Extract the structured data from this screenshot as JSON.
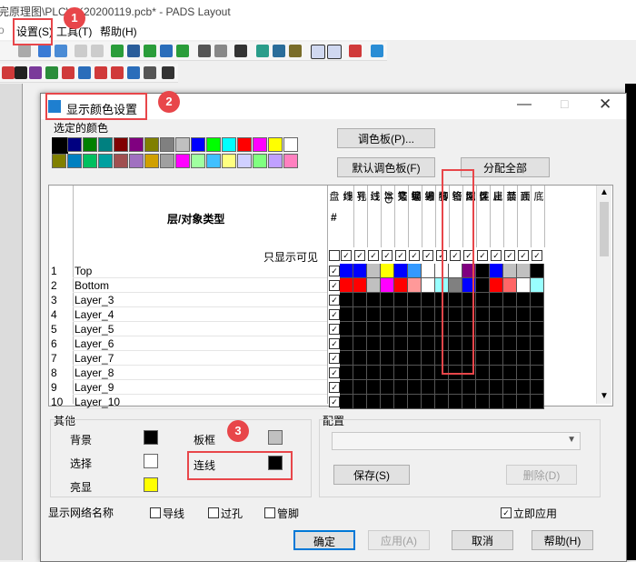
{
  "window": {
    "title": "完原理图\\PLCWK20200119.pcb* - PADS Layout"
  },
  "menu": {
    "settings": "设置(S)",
    "tools": "工具(T)",
    "help": "帮助(H)"
  },
  "dialog": {
    "title": "显示颜色设置",
    "selected_colors_label": "选定的颜色",
    "palette_button": "调色板(P)...",
    "default_palette_button": "默认调色板(F)",
    "assign_all_button": "分配全部",
    "table": {
      "layer_header": "层/对象类型",
      "hash_header": "#",
      "visible_only_label": "只显示可见",
      "columns": [
        "焊盘",
        "导线",
        "过孔",
        "2D 线",
        "文本",
        "铜箔",
        "错误",
        "参考编号",
        "管脚编号",
        "网络名",
        "类型",
        "属性",
        "禁止区域",
        "顶面",
        "底面"
      ],
      "rows": [
        {
          "num": "1",
          "name": "Top"
        },
        {
          "num": "2",
          "name": "Bottom"
        },
        {
          "num": "3",
          "name": "Layer_3"
        },
        {
          "num": "4",
          "name": "Layer_4"
        },
        {
          "num": "5",
          "name": "Layer_5"
        },
        {
          "num": "6",
          "name": "Layer_6"
        },
        {
          "num": "7",
          "name": "Layer_7"
        },
        {
          "num": "8",
          "name": "Layer_8"
        },
        {
          "num": "9",
          "name": "Layer_9"
        },
        {
          "num": "10",
          "name": "Layer_10"
        }
      ],
      "top_colors": [
        "#0000ff",
        "#0000ff",
        "#c0c0c0",
        "#ffff00",
        "#0000ff",
        "#3399ff",
        "#ffffff",
        "#ffffff",
        "#ffffff",
        "#800080",
        "#000000",
        "#0000ff",
        "#c0c0c0",
        "#c0c0c0",
        "#000000"
      ],
      "bottom_colors": [
        "#ff0000",
        "#ff0000",
        "#c0c0c0",
        "#ff00ff",
        "#ff0000",
        "#ff9999",
        "#ffffff",
        "#99ffff",
        "#808080",
        "#0000ff",
        "#000000",
        "#ff0000",
        "#ff6666",
        "#ffffff",
        "#99ffff"
      ]
    },
    "others": {
      "group_label": "其他",
      "background": "背景",
      "select": "选择",
      "highlight": "亮显",
      "board_frame": "板框",
      "connection": "连线"
    },
    "config": {
      "group_label": "配置",
      "save_button": "保存(S)",
      "delete_button": "删除(D)"
    },
    "show_net_names": {
      "label": "显示网络名称",
      "trace": "导线",
      "via": "过孔",
      "pin": "管脚"
    },
    "apply_immediately": "立即应用",
    "ok_button": "确定",
    "apply_button": "应用(A)",
    "cancel_button": "取消",
    "help_button": "帮助(H)"
  },
  "annotations": {
    "badge1": "1",
    "badge2": "2",
    "badge3": "3"
  },
  "colors": {
    "accent_red": "#e8464a",
    "highlight_yellow": "#ffff00"
  }
}
